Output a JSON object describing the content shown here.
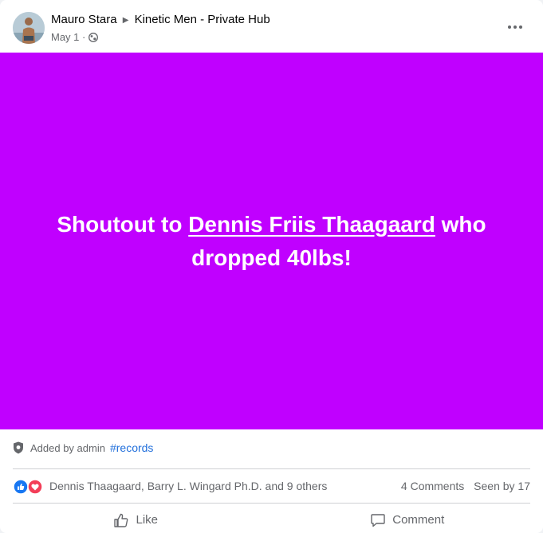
{
  "post": {
    "author": "Mauro Stara",
    "group": "Kinetic Men - Private Hub",
    "date": "May 1",
    "separator": "·",
    "banner": {
      "text_before": "Shoutout to ",
      "tagged": "Dennis Friis Thaagaard",
      "text_after": " who dropped 40lbs!",
      "background": "#c000ff"
    },
    "admin": {
      "label": "Added by admin",
      "hashtag": "#records"
    },
    "reactions": {
      "icons": [
        "like-reaction-icon",
        "love-reaction-icon"
      ],
      "summary": "Dennis Thaagaard, Barry L. Wingard Ph.D. and 9 others",
      "comments": "4 Comments",
      "seen": "Seen by 17"
    },
    "actions": {
      "like": "Like",
      "comment": "Comment"
    }
  }
}
